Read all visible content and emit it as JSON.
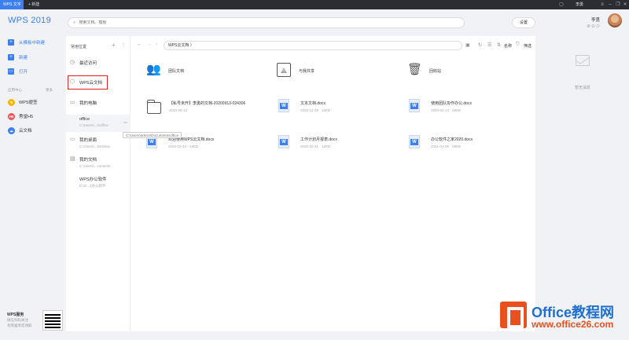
{
  "titlebar": {
    "active_tab": "WPS 文字",
    "new_tab": "+  新建",
    "user_chip": "李勇"
  },
  "sidebar": {
    "logo": "WPS 2019",
    "items": [
      {
        "label": "从模板中新建",
        "icon": "template-icon"
      },
      {
        "label": "新建",
        "icon": "new-icon"
      },
      {
        "label": "打开",
        "icon": "open-folder-icon"
      }
    ],
    "apps_header": "应用中心",
    "apps_more": "更多",
    "apps": [
      {
        "label": "WPS便签",
        "icon": "notes-icon",
        "color": "#f5b700"
      },
      {
        "label": "秀堂H5",
        "icon": "h5-icon",
        "color": "#ef5350"
      },
      {
        "label": "云文档",
        "icon": "cloud-doc-icon",
        "color": "#3b7ff2"
      }
    ],
    "service_title": "WPS服务",
    "service_sub1": "微信扫码关注",
    "service_sub2": "有惊喜等您领取"
  },
  "search": {
    "placeholder": "搜索文档、模板"
  },
  "settings_label": "设置",
  "user": {
    "name": "李勇"
  },
  "locations": {
    "header": "常用位置",
    "items": [
      {
        "label": "最近访问",
        "sub": "",
        "icon": "clock-icon"
      },
      {
        "label": "WPS云文档",
        "sub": "",
        "icon": "cloud-icon"
      },
      {
        "label": "我的电脑",
        "sub": "",
        "icon": "computer-icon"
      },
      {
        "label": "office",
        "sub": "C:\\Users\\...s\\office",
        "icon": "folder-icon"
      },
      {
        "label": "我的桌面",
        "sub": "C:\\Users\\...Desktop",
        "icon": "desktop-icon"
      },
      {
        "label": "我的文档",
        "sub": "C:\\Users\\...cuments",
        "icon": "documents-icon"
      },
      {
        "label": "WPS办公软件",
        "sub": "E:\\2\\...3办公软件",
        "icon": "folder-icon"
      }
    ],
    "tooltip": "C:\\Users\\admin\\Documents\\office"
  },
  "breadcrumb": "WPS云文档  〉",
  "toolbar": {
    "sort_label": "名称",
    "filter_label": "筛选"
  },
  "files": [
    {
      "name": "团队文档",
      "meta": "",
      "type": "team"
    },
    {
      "name": "与我共享",
      "meta": "",
      "type": "shared"
    },
    {
      "name": "回收站",
      "meta": "",
      "type": "trash"
    },
    {
      "name": "【私号未开】李勇的文档-20200913-024306",
      "meta": "2020-09-13",
      "type": "folder"
    },
    {
      "name": "文本文档.docx",
      "meta": "2020-12-28 · 13KB",
      "type": "doc"
    },
    {
      "name": "使用团队协作办公.docx",
      "meta": "2020-02-14 · 28KB",
      "type": "doc"
    },
    {
      "name": "欢迎使用WPS云文档.docx",
      "meta": "2020-02-14 · 15KB",
      "type": "doc"
    },
    {
      "name": "工作计划月报表.docx",
      "meta": "2020-10-21 · 12KB",
      "type": "doc"
    },
    {
      "name": "办公软件之家2020.docx",
      "meta": "2021-01-05 · 09KB",
      "type": "doc"
    }
  ],
  "right_panel": {
    "empty_text": "暂无消息"
  },
  "watermark": {
    "title": "Office教程网",
    "url": "www.office26.com"
  }
}
